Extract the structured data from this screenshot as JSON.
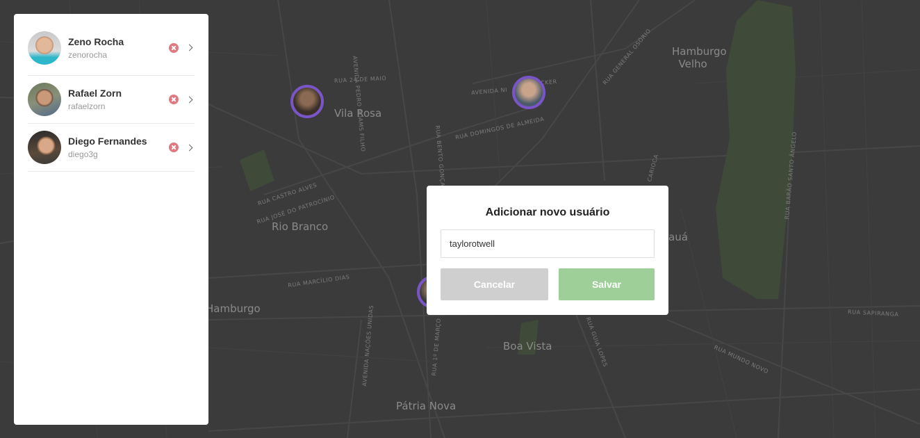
{
  "users": [
    {
      "name": "Zeno Rocha",
      "login": "zenorocha"
    },
    {
      "name": "Rafael Zorn",
      "login": "rafaelzorn"
    },
    {
      "name": "Diego Fernandes",
      "login": "diego3g"
    }
  ],
  "row_icons": {
    "remove": "remove-circle-icon",
    "open": "chevron-right-icon"
  },
  "modal": {
    "title": "Adicionar novo usuário",
    "input_value": "taylorotwell",
    "cancel_label": "Cancelar",
    "save_label": "Salvar"
  },
  "map": {
    "neighborhoods": [
      "Hamburgo Velho",
      "Vila Rosa",
      "Rio Branco",
      "Hamburgo",
      "Boa Vista",
      "Pátria Nova",
      "auá"
    ],
    "streets": [
      "RUA 24 DE MAIO",
      "AVENIDA PEDRO ADAMS FILHO",
      "AVENIDA NI",
      "CKER",
      "RUA DOMINGOS DE ALMEIDA",
      "RUA GENERAL OSÓRIO",
      "RUA BENTO GONÇALVES",
      "RUA CASTRO ALVES",
      "RUA JOSÉ DO PATROCÍNIO",
      "RUA MARCÍLIO DIAS",
      "AVENIDA NAÇÕES UNIDAS",
      "RUA 1º DE MARÇO",
      "RUA GUIA LOPES",
      "RUA SAPIRANGA",
      "RUA MUNDO NOVO",
      "RUA BARÃO SANTO ÂNGELO",
      "CARIOCA"
    ]
  },
  "colors": {
    "map_bg": "#3b3b3b",
    "park": "#3f4a38",
    "marker_ring": "#7a55c8",
    "remove": "#d9636b",
    "save_button": "#9fcf98",
    "cancel_button": "#cfcfcf"
  }
}
